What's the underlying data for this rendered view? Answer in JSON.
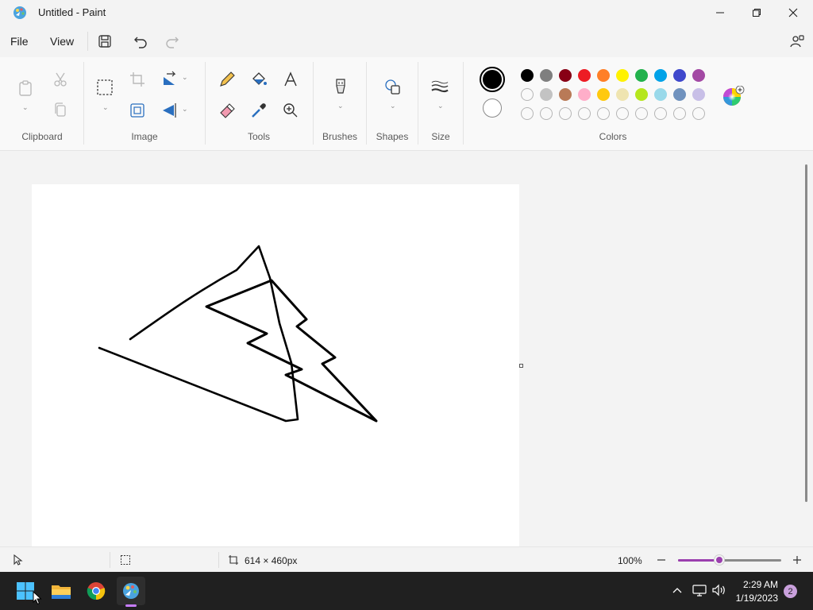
{
  "window": {
    "title": "Untitled - Paint",
    "minimize_icon": "minimize-icon",
    "maximize_icon": "restore-icon",
    "close_icon": "close-icon"
  },
  "menu": {
    "file": "File",
    "view": "View",
    "icons": [
      "save-icon",
      "undo-icon",
      "redo-icon",
      "account-icon"
    ]
  },
  "ribbon": {
    "groups": {
      "clipboard": "Clipboard",
      "image": "Image",
      "tools": "Tools",
      "brushes": "Brushes",
      "shapes": "Shapes",
      "size": "Size",
      "colors": "Colors"
    }
  },
  "colors": {
    "primary": "#000000",
    "secondary": "#ffffff",
    "row1": [
      "#000000",
      "#7f7f7f",
      "#880015",
      "#ed1c24",
      "#ff7f27",
      "#fff200",
      "#22b14c",
      "#00a2e8",
      "#3f48cc",
      "#a349a4"
    ],
    "row2": [
      "#ffffff",
      "#c3c3c3",
      "#b97a57",
      "#ffaec9",
      "#ffc90e",
      "#efe4b0",
      "#b5e61d",
      "#99d9ea",
      "#7092be",
      "#c8bfe7"
    ],
    "row3_empty_count": 10
  },
  "status": {
    "canvas_size": "614 × 460px",
    "zoom": "100%",
    "zoom_level": 0.4
  },
  "taskbar": {
    "time": "2:29 AM",
    "date": "1/19/2023",
    "notification_count": "2",
    "apps": [
      "windows-start-icon",
      "file-explorer-icon",
      "chrome-icon",
      "paint-icon"
    ]
  }
}
